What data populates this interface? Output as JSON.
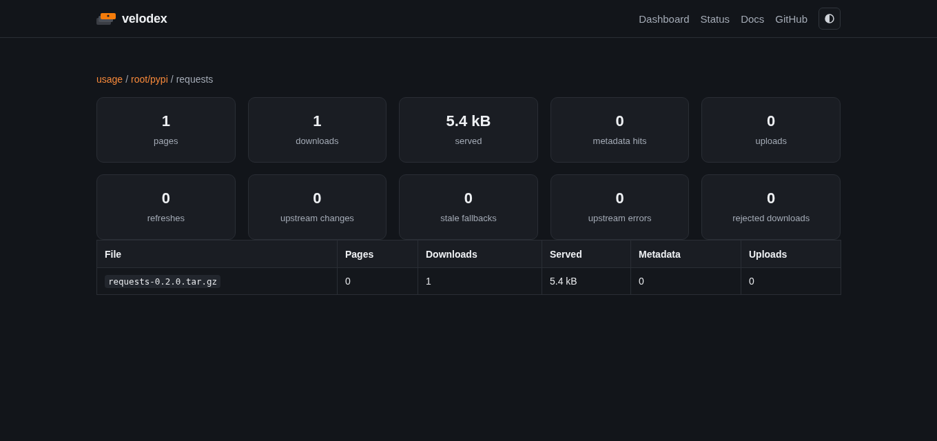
{
  "header": {
    "brand": "velodex",
    "nav": [
      "Dashboard",
      "Status",
      "Docs",
      "GitHub"
    ]
  },
  "breadcrumb": {
    "separator": "/",
    "items": [
      {
        "label": "usage",
        "kind": "link"
      },
      {
        "label": "root/pypi",
        "kind": "link"
      },
      {
        "label": "requests",
        "kind": "current"
      }
    ]
  },
  "stats": [
    {
      "value": "1",
      "label": "pages"
    },
    {
      "value": "1",
      "label": "downloads"
    },
    {
      "value": "5.4 kB",
      "label": "served"
    },
    {
      "value": "0",
      "label": "metadata hits"
    },
    {
      "value": "0",
      "label": "uploads"
    },
    {
      "value": "0",
      "label": "refreshes"
    },
    {
      "value": "0",
      "label": "upstream changes"
    },
    {
      "value": "0",
      "label": "stale fallbacks"
    },
    {
      "value": "0",
      "label": "upstream errors"
    },
    {
      "value": "0",
      "label": "rejected downloads"
    }
  ],
  "table": {
    "columns": [
      "File",
      "Pages",
      "Downloads",
      "Served",
      "Metadata",
      "Uploads"
    ],
    "rows": [
      {
        "cells": [
          "requests-0.2.0.tar.gz",
          "0",
          "1",
          "5.4 kB",
          "0",
          "0"
        ]
      }
    ]
  }
}
